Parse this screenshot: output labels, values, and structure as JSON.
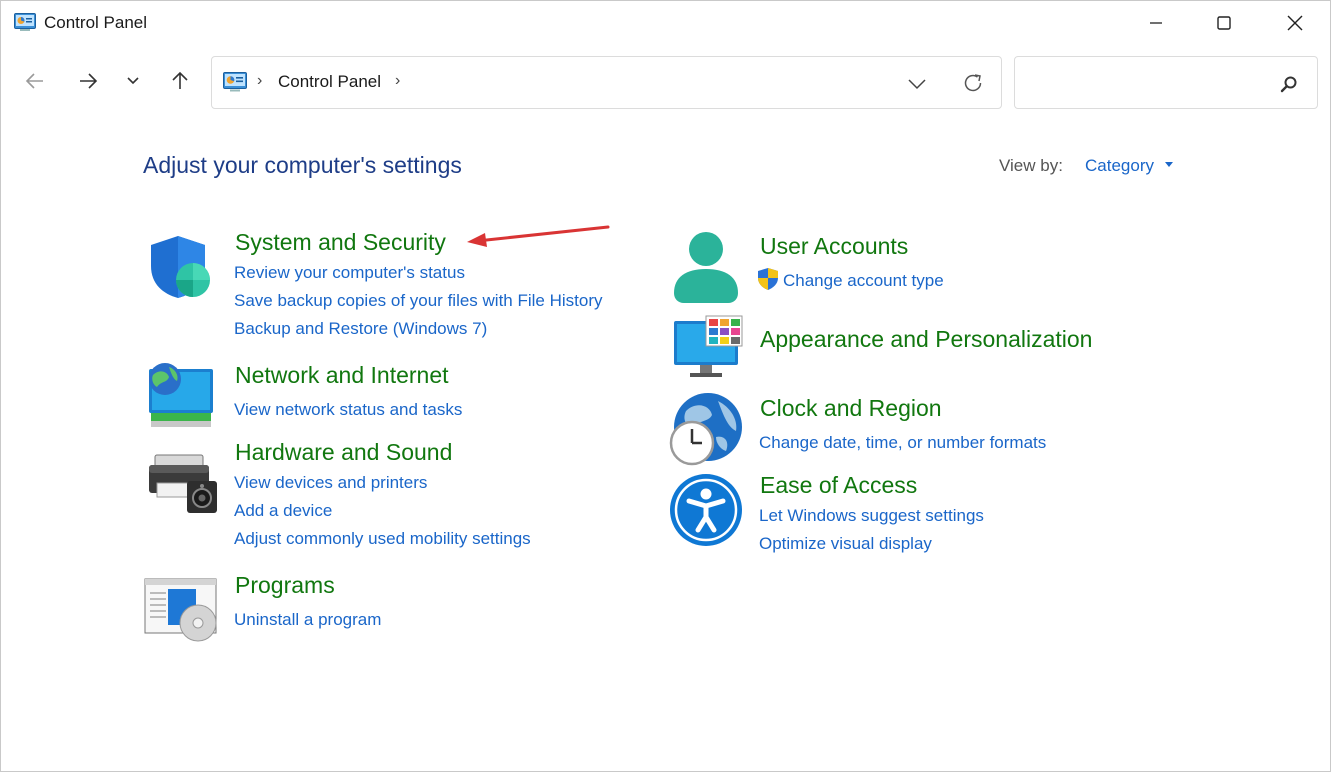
{
  "window": {
    "title": "Control Panel",
    "minimize_icon": "minimize-icon",
    "maximize_icon": "maximize-icon",
    "close_icon": "close-icon"
  },
  "nav": {
    "back_icon": "arrow-left-icon",
    "forward_icon": "arrow-right-icon",
    "recent_icon": "chevron-down-icon",
    "up_icon": "arrow-up-icon"
  },
  "address": {
    "crumb": "Control Panel",
    "separator": "›"
  },
  "search": {
    "value": "",
    "placeholder": ""
  },
  "content": {
    "heading": "Adjust your computer's settings",
    "view_by_label": "View by:",
    "view_by_value": "Category"
  },
  "categories_left": [
    {
      "title": "System and Security",
      "icon": "shield-icon",
      "links": [
        "Review your computer's status",
        "Save backup copies of your files with File History",
        "Backup and Restore (Windows 7)"
      ]
    },
    {
      "title": "Network and Internet",
      "icon": "network-globe-icon",
      "links": [
        "View network status and tasks"
      ]
    },
    {
      "title": "Hardware and Sound",
      "icon": "printer-speaker-icon",
      "links": [
        "View devices and printers",
        "Add a device",
        "Adjust commonly used mobility settings"
      ]
    },
    {
      "title": "Programs",
      "icon": "programs-disc-icon",
      "links": [
        "Uninstall a program"
      ]
    }
  ],
  "categories_right": [
    {
      "title": "User Accounts",
      "icon": "user-icon",
      "links": [
        "Change account type"
      ]
    },
    {
      "title": "Appearance and Personalization",
      "icon": "monitor-palette-icon",
      "links": []
    },
    {
      "title": "Clock and Region",
      "icon": "globe-clock-icon",
      "links": [
        "Change date, time, or number formats"
      ]
    },
    {
      "title": "Ease of Access",
      "icon": "accessibility-icon",
      "links": [
        "Let Windows suggest settings",
        "Optimize visual display"
      ]
    }
  ],
  "colors": {
    "heading": "#1e3d87",
    "category_title": "#11770f",
    "link": "#1a66c9",
    "annotation_arrow": "#d93434"
  }
}
